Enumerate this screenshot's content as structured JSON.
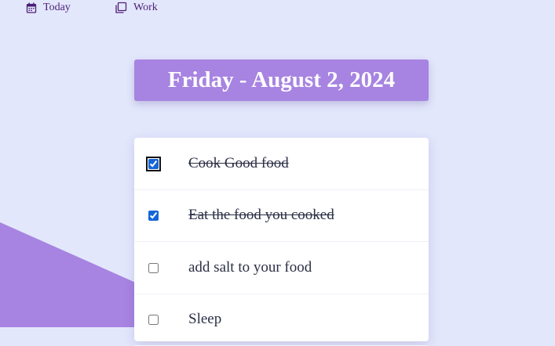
{
  "nav": {
    "items": [
      {
        "label": "Today",
        "icon": "calendar-icon"
      },
      {
        "label": "Work",
        "icon": "copy-icon"
      }
    ]
  },
  "header": {
    "date": "Friday - August 2, 2024"
  },
  "todos": [
    {
      "text": "Cook Good food",
      "done": true
    },
    {
      "text": "Eat the food you cooked",
      "done": true
    },
    {
      "text": "add salt to your food",
      "done": false
    },
    {
      "text": "Sleep",
      "done": false
    }
  ],
  "colors": {
    "background": "#e3e7fc",
    "accent": "#a784e1",
    "nav_text": "#4a1f74"
  }
}
